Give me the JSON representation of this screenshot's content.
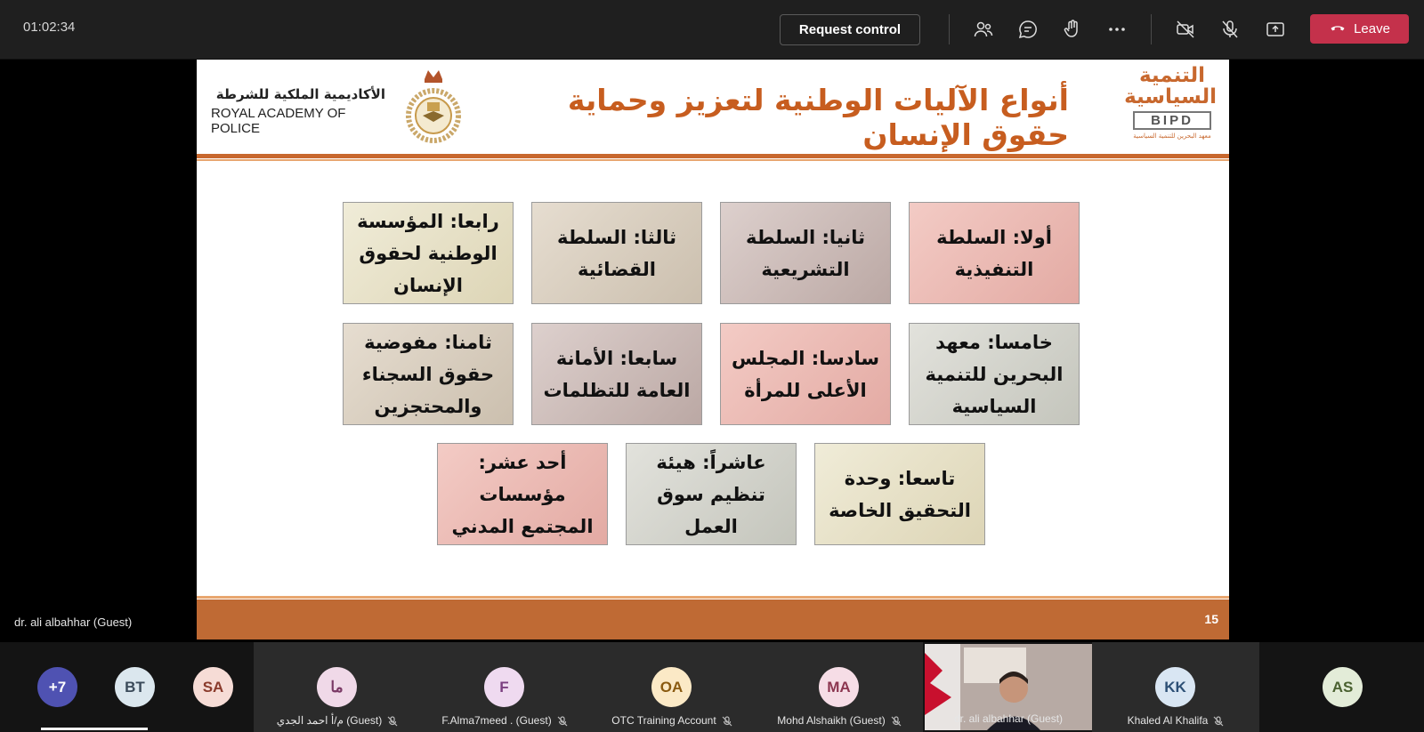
{
  "toolbar": {
    "timer": "01:02:34",
    "request_control": "Request control",
    "leave": "Leave",
    "icons": [
      "people-icon",
      "chat-icon",
      "raise-hand-icon",
      "more-icon",
      "camera-off-icon",
      "mic-off-icon",
      "share-icon",
      "hang-up-icon"
    ],
    "leave_color": "#c4314b"
  },
  "slide": {
    "academy_ar": "الأكاديمية الملكية للشرطة",
    "academy_en": "ROYAL ACADEMY OF POLICE",
    "title": "أنواع الآليات الوطنية لتعزيز وحماية حقوق الإنسان",
    "logo_text": "التنمية السياسية",
    "logo_short": "BIPD",
    "logo_ar_sub": "معهد البحرين للتنمية السياسية",
    "accent": "#c75d1f",
    "boxes": [
      "أولا: السلطة التنفيذية",
      "ثانيا: السلطة التشريعية",
      "ثالثا: السلطة القضائية",
      "رابعا: المؤسسة الوطنية لحقوق الإنسان",
      "خامسا: معهد البحرين للتنمية السياسية",
      "سادسا: المجلس الأعلى للمرأة",
      "سابعا: الأمانة العامة للتظلمات",
      "ثامنا: مفوضية حقوق السجناء والمحتجزين",
      "تاسعا: وحدة التحقيق الخاصة",
      "عاشراً: هيئة تنظيم سوق العمل",
      "أحد عشر: مؤسسات المجتمع المدني"
    ],
    "slide_number": "15"
  },
  "presenter_label": "dr. ali albahhar (Guest)",
  "participants": [
    {
      "initials": "+7",
      "bg": "#4f52b2",
      "fg": "#ffffff"
    },
    {
      "initials": "BT",
      "bg": "#dbe7ee",
      "fg": "#3b4b5a"
    },
    {
      "initials": "SA",
      "bg": "#f6dcd6",
      "fg": "#8a3b2c"
    },
    {
      "initials": "ما",
      "name": "م/أ احمد الجدي (Guest)",
      "bg": "#f0d9e8",
      "fg": "#7b3a66"
    },
    {
      "initials": "F",
      "name": "F.Alma7meed . (Guest)",
      "bg": "#efdaf0",
      "fg": "#7b3f80"
    },
    {
      "initials": "OA",
      "name": "OTC Training Account",
      "bg": "#fbe9c6",
      "fg": "#8a5a10"
    },
    {
      "initials": "MA",
      "name": "Mohd Alshaikh (Guest)",
      "bg": "#f6dde6",
      "fg": "#8c3650"
    },
    {
      "name": "dr. ali albahhar (Guest)"
    },
    {
      "initials": "KK",
      "name": "Khaled Al Khalifa",
      "bg": "#d9e6f3",
      "fg": "#2c4f75"
    },
    {
      "initials": "AS",
      "bg": "#e3ecd8",
      "fg": "#4a6130"
    }
  ]
}
